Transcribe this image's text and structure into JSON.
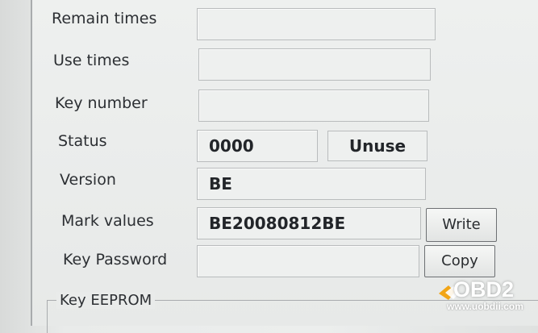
{
  "rows": [
    {
      "label": "Remain times",
      "value": ""
    },
    {
      "label": "Use times",
      "value": ""
    },
    {
      "label": "Key number",
      "value": ""
    },
    {
      "label": "Status",
      "value": "0000",
      "state": "Unuse"
    },
    {
      "label": "Version",
      "value": "BE"
    },
    {
      "label": "Mark values",
      "value": "BE20080812BE",
      "button": "Write"
    },
    {
      "label": "Key Password",
      "value": "",
      "button": "Copy"
    }
  ],
  "group": {
    "title": "Key EEPROM"
  },
  "watermark": {
    "brand": "OBD2",
    "url": "www.uobdii.com",
    "accent": "#f2a516"
  }
}
